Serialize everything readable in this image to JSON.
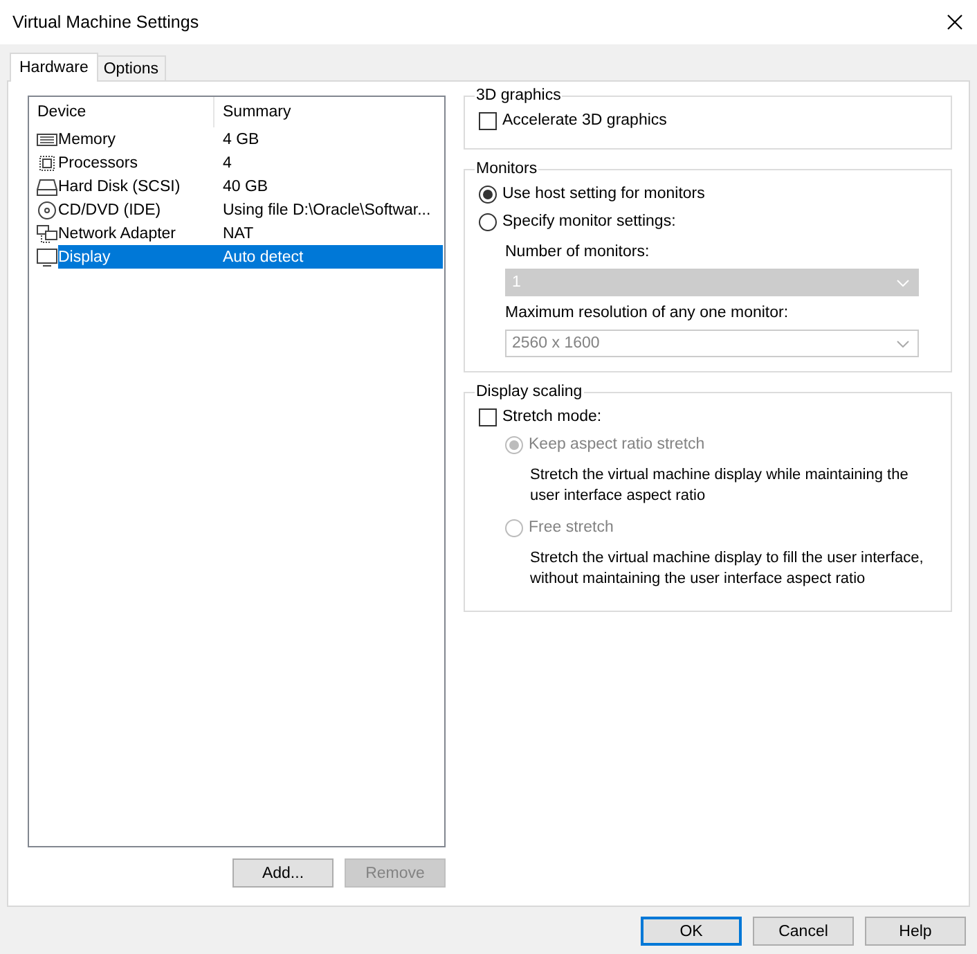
{
  "window": {
    "title": "Virtual Machine Settings"
  },
  "tabs": [
    {
      "label": "Hardware",
      "selected": true
    },
    {
      "label": "Options",
      "selected": false
    }
  ],
  "device_list": {
    "columns": [
      "Device",
      "Summary"
    ],
    "rows": [
      {
        "kind": "memory",
        "device": "Memory",
        "summary": "4 GB",
        "selected": false
      },
      {
        "kind": "processor",
        "device": "Processors",
        "summary": "4",
        "selected": false
      },
      {
        "kind": "disk",
        "device": "Hard Disk (SCSI)",
        "summary": "40 GB",
        "selected": false
      },
      {
        "kind": "cd",
        "device": "CD/DVD (IDE)",
        "summary": "Using file D:\\Oracle\\Softwar...",
        "selected": false
      },
      {
        "kind": "network",
        "device": "Network Adapter",
        "summary": "NAT",
        "selected": false
      },
      {
        "kind": "display",
        "device": "Display",
        "summary": "Auto detect",
        "selected": true
      }
    ]
  },
  "list_buttons": [
    {
      "label": "Add...",
      "disabled": false
    },
    {
      "label": "Remove",
      "disabled": true
    }
  ],
  "groups": [
    {
      "title": "3D graphics",
      "controls": [
        {
          "kind": "checkbox",
          "label": "Accelerate 3D graphics",
          "checked": false,
          "disabled": false
        }
      ]
    },
    {
      "title": "Monitors",
      "controls": [
        {
          "kind": "radio",
          "label": "Use host setting for monitors",
          "selected": true,
          "disabled": false
        },
        {
          "kind": "radio",
          "label": "Specify monitor settings:",
          "selected": false,
          "disabled": false,
          "children": [
            {
              "kind": "dropdown",
              "label": "Number of monitors:",
              "value": "1",
              "disabled": true
            },
            {
              "kind": "combobox",
              "label": "Maximum resolution of any one monitor:",
              "value": "2560 x 1600",
              "disabled": true
            }
          ]
        }
      ]
    },
    {
      "title": "Display scaling",
      "controls": [
        {
          "kind": "checkbox",
          "label": "Stretch mode:",
          "checked": false,
          "disabled": false,
          "children": [
            {
              "kind": "radio",
              "label": "Keep aspect ratio stretch",
              "selected": true,
              "disabled": true
            },
            {
              "kind": "note",
              "label": "Stretch the virtual machine display while maintaining the user interface aspect ratio"
            },
            {
              "kind": "radio",
              "label": "Free stretch",
              "selected": false,
              "disabled": true
            },
            {
              "kind": "note",
              "label": "Stretch the virtual machine display to fill the user interface, without maintaining the user interface aspect ratio"
            }
          ]
        }
      ]
    }
  ],
  "dialog_buttons": [
    {
      "label": "OK",
      "default": true
    },
    {
      "label": "Cancel",
      "default": false
    },
    {
      "label": "Help",
      "default": false
    }
  ]
}
